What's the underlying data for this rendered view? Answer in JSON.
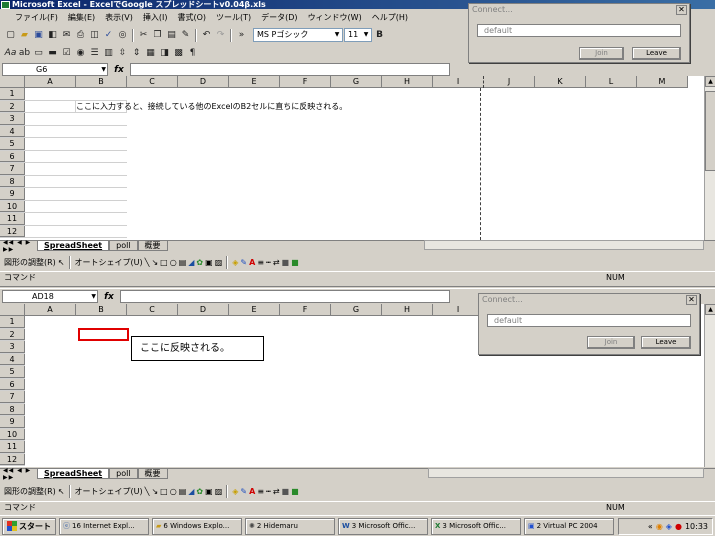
{
  "window": {
    "title": "Microsoft Excel - ExcelでGoogle スプレッドシートv0.04β.xls"
  },
  "menu": [
    "ファイル(F)",
    "編集(E)",
    "表示(V)",
    "挿入(I)",
    "書式(O)",
    "ツール(T)",
    "データ(D)",
    "ウィンドウ(W)",
    "ヘルプ(H)"
  ],
  "toolbar": {
    "font": "MS Pゴシック",
    "size": "11",
    "bold": "B"
  },
  "top_pane": {
    "name_box": "G6",
    "fx": "fx",
    "columns": [
      "A",
      "B",
      "C",
      "D",
      "E",
      "F",
      "G",
      "H",
      "I",
      "J",
      "K",
      "L",
      "M"
    ],
    "rows": [
      "1",
      "2",
      "3",
      "4",
      "5",
      "6",
      "7",
      "8",
      "9",
      "10",
      "11",
      "12"
    ],
    "cell_b2": "ここに入力すると、接続している他のExcelのB2セルに直ちに反映される。",
    "sheet_tabs": [
      "SpreadSheet",
      "poll",
      "概要"
    ],
    "status": "コマンド",
    "num": "NUM"
  },
  "bottom_pane": {
    "name_box": "AD18",
    "fx": "fx",
    "columns": [
      "A",
      "B",
      "C",
      "D",
      "E",
      "F",
      "G",
      "H",
      "I"
    ],
    "rows": [
      "1",
      "2",
      "3",
      "4",
      "5",
      "6",
      "7",
      "8",
      "9",
      "10",
      "11",
      "12"
    ],
    "callout": "ここに反映される。",
    "sheet_tabs": [
      "SpreadSheet",
      "poll",
      "概要"
    ],
    "status": "コマンド",
    "num": "NUM"
  },
  "drawbar": {
    "adjust": "図形の調整(R)",
    "autoshape": "オートシェイプ(U)"
  },
  "connect_dialog": {
    "title": "Connect...",
    "input": "default",
    "join": "Join",
    "leave": "Leave"
  },
  "taskbar": {
    "start": "スタート",
    "tasks": [
      "16 Internet Expl...",
      "6 Windows Explo...",
      "2 Hidemaru",
      "3 Microsoft Offic...",
      "3 Microsoft Offic...",
      "2 Virtual PC 2004"
    ],
    "clock": "10:33"
  }
}
